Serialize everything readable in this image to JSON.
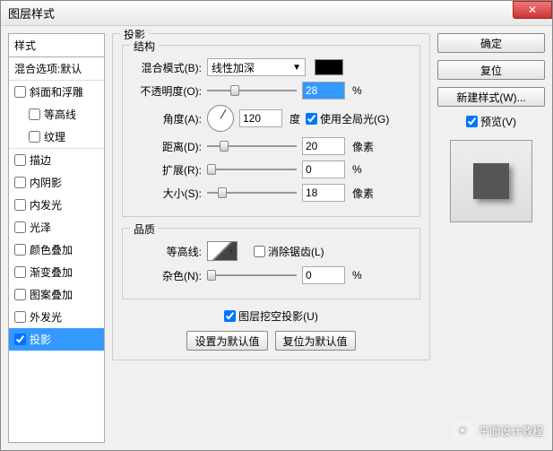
{
  "window": {
    "title": "图层样式"
  },
  "left": {
    "header": "样式",
    "blend_defaults": "混合选项:默认",
    "items": [
      {
        "label": "斜面和浮雕",
        "checked": false,
        "selected": false,
        "indent": 0
      },
      {
        "label": "等高线",
        "checked": false,
        "selected": false,
        "indent": 1
      },
      {
        "label": "纹理",
        "checked": false,
        "selected": false,
        "indent": 1
      },
      {
        "label": "描边",
        "checked": false,
        "selected": false,
        "indent": 0
      },
      {
        "label": "内阴影",
        "checked": false,
        "selected": false,
        "indent": 0
      },
      {
        "label": "内发光",
        "checked": false,
        "selected": false,
        "indent": 0
      },
      {
        "label": "光泽",
        "checked": false,
        "selected": false,
        "indent": 0
      },
      {
        "label": "颜色叠加",
        "checked": false,
        "selected": false,
        "indent": 0
      },
      {
        "label": "渐变叠加",
        "checked": false,
        "selected": false,
        "indent": 0
      },
      {
        "label": "图案叠加",
        "checked": false,
        "selected": false,
        "indent": 0
      },
      {
        "label": "外发光",
        "checked": false,
        "selected": false,
        "indent": 0
      },
      {
        "label": "投影",
        "checked": true,
        "selected": true,
        "indent": 0
      }
    ]
  },
  "middle": {
    "section_title": "投影",
    "structure": {
      "title": "结构",
      "blend_mode_label": "混合模式(B):",
      "blend_mode_value": "线性加深",
      "opacity_label": "不透明度(O):",
      "opacity_value": "28",
      "opacity_unit": "%",
      "angle_label": "角度(A):",
      "angle_value": "120",
      "angle_unit": "度",
      "use_global_light_label": "使用全局光(G)",
      "use_global_light_checked": true,
      "distance_label": "距离(D):",
      "distance_value": "20",
      "distance_unit": "像素",
      "spread_label": "扩展(R):",
      "spread_value": "0",
      "spread_unit": "%",
      "size_label": "大小(S):",
      "size_value": "18",
      "size_unit": "像素"
    },
    "quality": {
      "title": "品质",
      "contour_label": "等高线:",
      "anti_alias_label": "消除锯齿(L)",
      "anti_alias_checked": false,
      "noise_label": "杂色(N):",
      "noise_value": "0",
      "noise_unit": "%"
    },
    "knockout_label": "图层挖空投影(U)",
    "knockout_checked": true,
    "set_default": "设置为默认值",
    "reset_default": "复位为默认值"
  },
  "right": {
    "ok": "确定",
    "cancel": "复位",
    "new_style": "新建样式(W)...",
    "preview_label": "预览(V)",
    "preview_checked": true
  },
  "watermark": "平面设计教程"
}
